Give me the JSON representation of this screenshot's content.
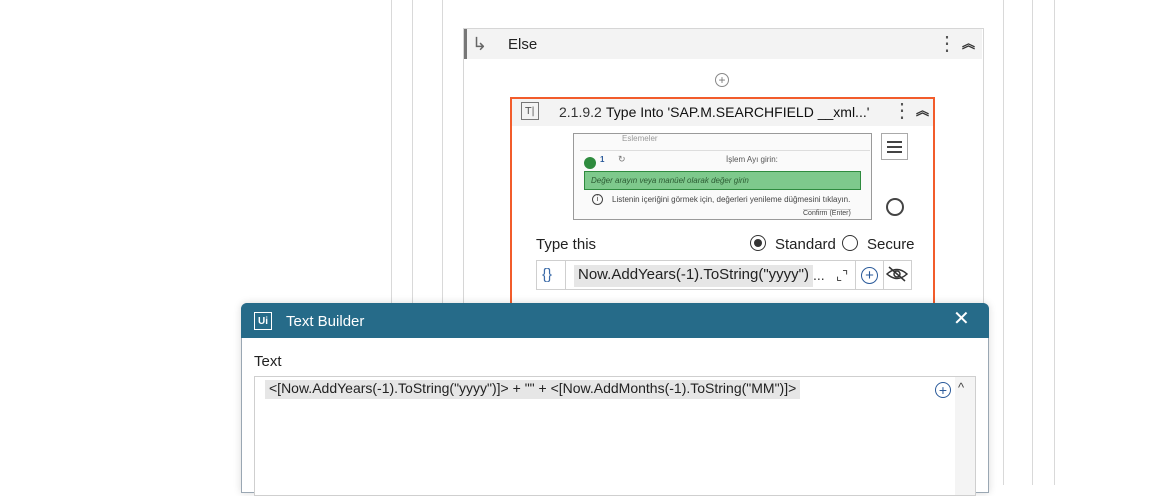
{
  "else_block": {
    "label": "Else"
  },
  "activity": {
    "number": "2.1.9.2",
    "title": "Type Into 'SAP.M.SEARCHFIELD __xml...'",
    "preview": {
      "top_text": "Eslemeler",
      "step_number": "1",
      "subtitle": "İşlem Ayı girin:",
      "field_placeholder": "Değer arayın veya manüel olarak değer girin",
      "info_text": "Listenin içeriğini görmek için, değerleri yenileme düğmesini tıklayın.",
      "confirm_button": "Confirm (Enter)"
    },
    "type_this_label": "Type this",
    "mode_standard": "Standard",
    "mode_secure": "Secure",
    "selected_mode": "Standard",
    "expression": "Now.AddYears(-1).ToString(\"yyyy\")",
    "ellipsis": "..."
  },
  "dialog": {
    "title": "Text Builder",
    "logo": "Ui",
    "text_label": "Text",
    "content": "<[Now.AddYears(-1).ToString(\"yyyy\")]> + \"\" + <[Now.AddMonths(-1).ToString(\"MM\")]>"
  },
  "icons": {
    "else": "return-arrow-icon",
    "more": "kebab-menu-icon",
    "collapse": "double-chevron-up-icon",
    "add": "plus-circle-icon",
    "type_into": "type-into-icon",
    "menu": "hamburger-icon",
    "target": "target-icon",
    "expand": "expand-icon",
    "hide": "eye-slash-icon",
    "close": "close-icon"
  },
  "colors": {
    "selection_border": "#f25c2b",
    "dialog_title_bg": "#266b89",
    "highlight_green": "#7ec98c"
  }
}
